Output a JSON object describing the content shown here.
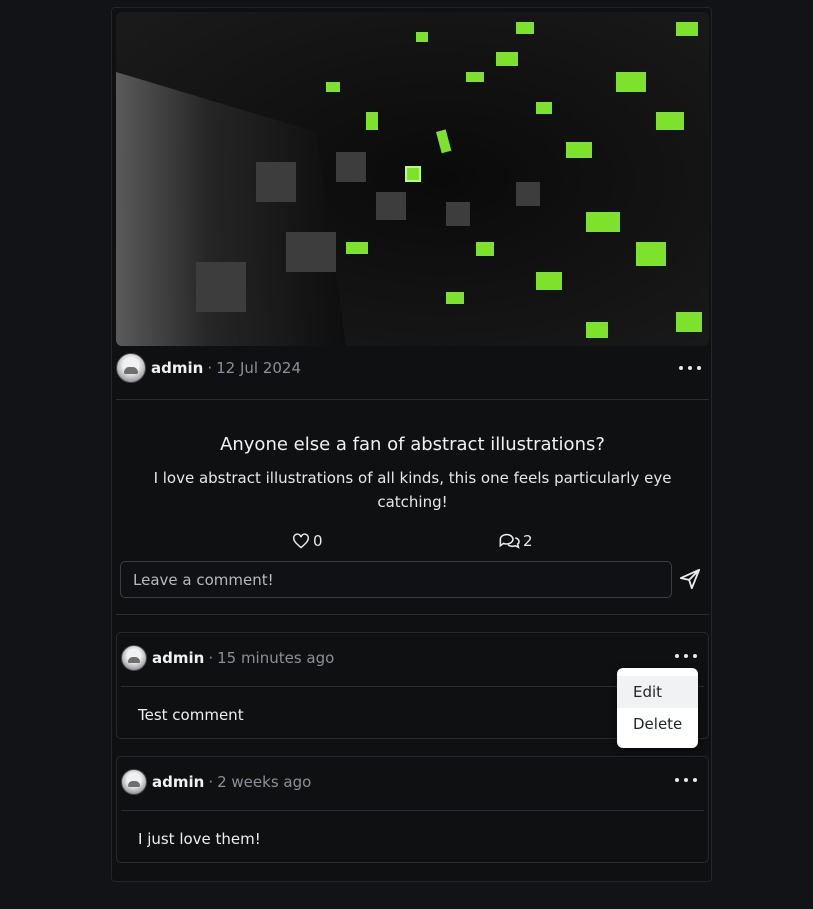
{
  "post": {
    "author": "admin",
    "separator": "·",
    "date": "12 Jul 2024",
    "title": "Anyone else a fan of abstract illustrations?",
    "description": "I love abstract illustrations of all kinds, this one feels particularly eye catching!",
    "likes": "0",
    "comments_count": "2",
    "comment_placeholder": "Leave a comment!"
  },
  "comments": [
    {
      "author": "admin",
      "separator": "·",
      "time": "15 minutes ago",
      "text": "Test comment"
    },
    {
      "author": "admin",
      "separator": "·",
      "time": "2 weeks ago",
      "text": "I just love them!"
    }
  ],
  "menu": {
    "edit": "Edit",
    "delete": "Delete"
  },
  "colors": {
    "background": "#121316",
    "accent_green": "#7ee12b",
    "menu_bg": "#ffffff"
  },
  "icons": {
    "like": "heart-icon",
    "comments": "comments-icon",
    "send": "send-icon",
    "more": "more-dots-icon"
  }
}
